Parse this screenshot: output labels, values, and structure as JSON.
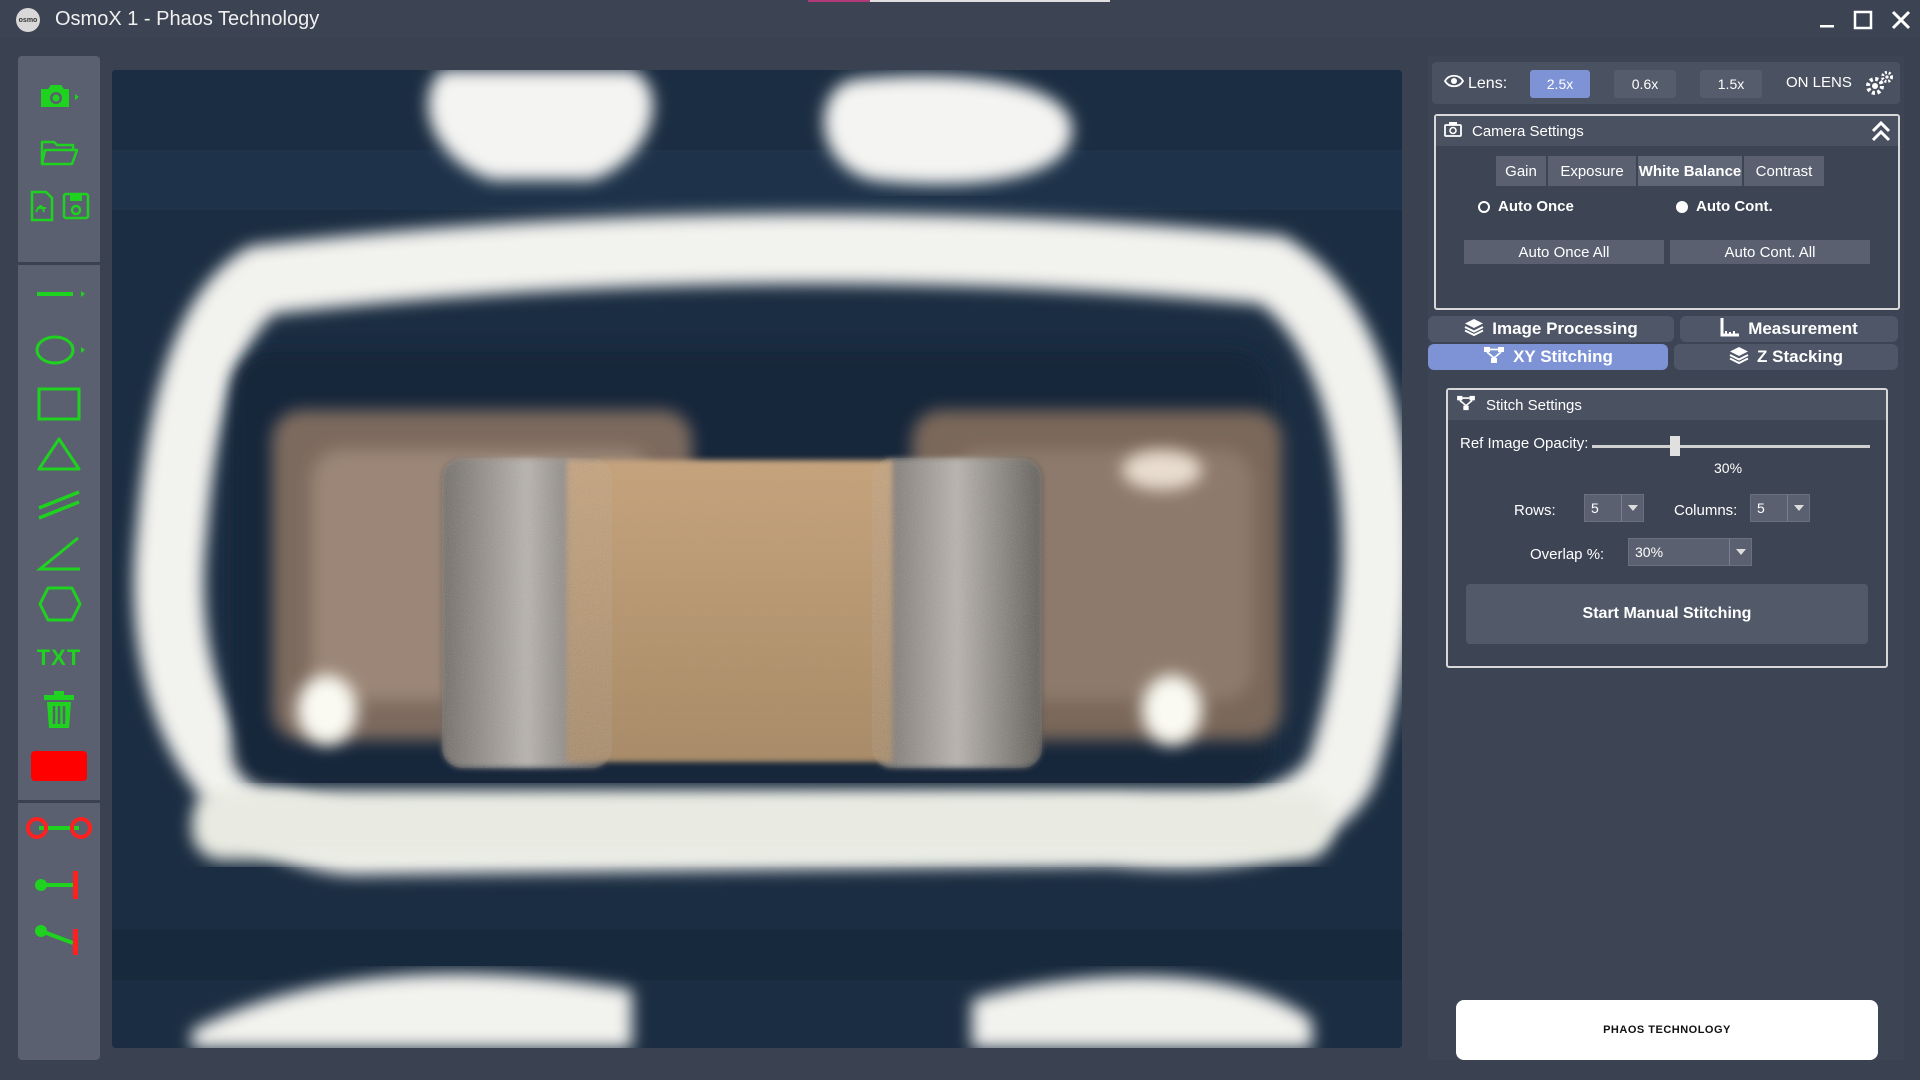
{
  "window": {
    "title": "OsmoX 1 - Phaos Technology",
    "logo_text": "osmo",
    "minimize_icon": "minimize-icon",
    "maximize_icon": "maximize-icon",
    "close_icon": "close-icon"
  },
  "toolbar": {
    "txt_label": "TXT",
    "active_color": "#ff0000",
    "icon_color": "#1fd21f"
  },
  "lens": {
    "label": "Lens:",
    "options": [
      "2.5x",
      "0.6x",
      "1.5x"
    ],
    "selected": "2.5x",
    "on_lens": "ON LENS"
  },
  "camera_settings": {
    "title": "Camera Settings",
    "tabs": [
      "Gain",
      "Exposure",
      "White Balance",
      "Contrast"
    ],
    "active_tab": "White Balance",
    "radio_auto_once": "Auto Once",
    "radio_auto_cont": "Auto Cont.",
    "selected_radio": "Auto Once",
    "btn_auto_once_all": "Auto Once All",
    "btn_auto_cont_all": "Auto Cont. All"
  },
  "main_tabs": {
    "image_processing": "Image Processing",
    "measurement": "Measurement",
    "xy_stitching": "XY Stitching",
    "z_stacking": "Z Stacking",
    "active": "XY Stitching"
  },
  "stitch_settings": {
    "title": "Stitch Settings",
    "opacity_label": "Ref Image Opacity:",
    "opacity_value": "30%",
    "opacity_fraction": 0.3,
    "rows_label": "Rows:",
    "rows_value": "5",
    "columns_label": "Columns:",
    "columns_value": "5",
    "overlap_label": "Overlap %:",
    "overlap_value": "30%",
    "start_button": "Start Manual Stitching"
  },
  "footer_logo": {
    "text": "PHAOS TECHNOLOGY"
  }
}
